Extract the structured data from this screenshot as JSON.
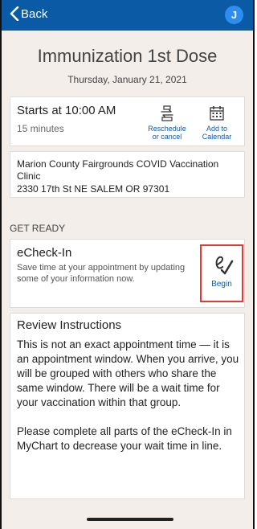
{
  "navbar": {
    "back_label": "Back",
    "avatar_initial": "J"
  },
  "header": {
    "title": "Immunization 1st Dose",
    "date": "Thursday, January 21, 2021"
  },
  "appointment": {
    "start": "Starts at 10:00 AM",
    "duration": "15 minutes",
    "reschedule_line1": "Reschedule",
    "reschedule_line2": "or cancel",
    "calendar_line1": "Add to",
    "calendar_line2": "Calendar"
  },
  "location": {
    "name": "Marion County Fairgrounds COVID Vaccination Clinic",
    "address": "2330 17th St NE SALEM OR 97301"
  },
  "section_label": "GET READY",
  "echeckin": {
    "title": "eCheck-In",
    "description": "Save time at your appointment by updating some of your information now.",
    "begin_label": "Begin"
  },
  "review": {
    "title": "Review Instructions",
    "paragraph1": "This is not an exact appointment time — it is an appointment window. When you arrive, you will be grouped with others who share the same window. There will be a wait time for your vaccination within that group.",
    "paragraph2": "Please complete all parts of the eCheck-In in MyChart to decrease your wait time in line."
  },
  "colors": {
    "accent": "#0b5aa5",
    "highlight": "#e53935",
    "background": "#f3eeea"
  }
}
